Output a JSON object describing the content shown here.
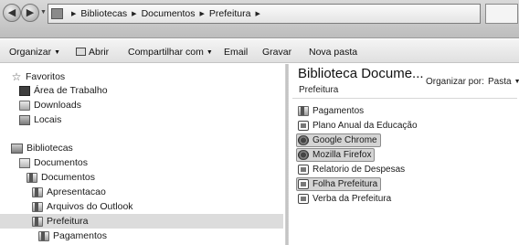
{
  "addressbar": {
    "breadcrumbs": [
      "Bibliotecas",
      "Documentos",
      "Prefeitura"
    ]
  },
  "toolbar": {
    "organizar": "Organizar",
    "abrir": "Abrir",
    "compartilhar": "Compartilhar com",
    "email": "Email",
    "gravar": "Gravar",
    "nova_pasta": "Nova pasta"
  },
  "navpane": {
    "favoritos": "Favoritos",
    "area_trabalho": "Área de Trabalho",
    "downloads": "Downloads",
    "locais": "Locais",
    "bibliotecas": "Bibliotecas",
    "documentos_lib": "Documentos",
    "documentos": "Documentos",
    "apresentacao": "Apresentacao",
    "arquivos_outlook": "Arquivos do Outlook",
    "prefeitura": "Prefeitura",
    "pagamentos": "Pagamentos"
  },
  "content": {
    "title": "Biblioteca Docume...",
    "subtitle": "Prefeitura",
    "sort_label": "Organizar por:",
    "sort_value": "Pasta",
    "files": [
      {
        "name": "Pagamentos",
        "icon": "folder-icon",
        "highlighted": false
      },
      {
        "name": "Plano Anual da Educação",
        "icon": "shortcut-icon",
        "highlighted": false
      },
      {
        "name": "Google Chrome",
        "icon": "chrome-icon",
        "highlighted": true
      },
      {
        "name": "Mozilla Firefox",
        "icon": "firefox-icon",
        "highlighted": true
      },
      {
        "name": "Relatorio de Despesas",
        "icon": "shortcut-icon",
        "highlighted": false
      },
      {
        "name": "Folha Prefeitura",
        "icon": "shortcut-icon",
        "highlighted": true
      },
      {
        "name": "Verba da Prefeitura",
        "icon": "shortcut-icon",
        "highlighted": false
      }
    ]
  }
}
